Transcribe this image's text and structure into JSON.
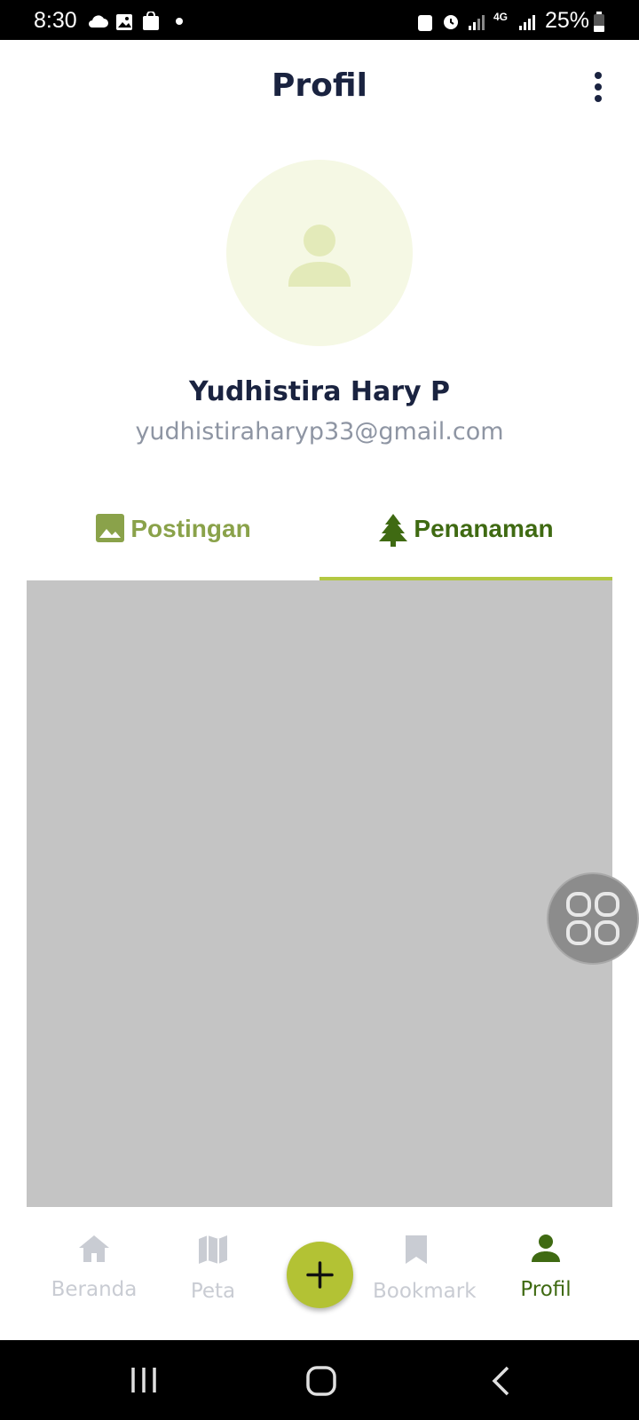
{
  "status_bar": {
    "time": "8:30",
    "battery": "25%",
    "network": "4G"
  },
  "app_bar": {
    "title": "Profil"
  },
  "profile": {
    "name": "Yudhistira Hary P",
    "email": "yudhistiraharyp33@gmail.com"
  },
  "tabs": [
    {
      "label": "Postingan",
      "icon": "image-icon",
      "selected": false
    },
    {
      "label": "Penanaman",
      "icon": "tree-icon",
      "selected": true
    }
  ],
  "bottom_nav": {
    "items": [
      {
        "label": "Beranda",
        "icon": "home-icon",
        "active": false
      },
      {
        "label": "Peta",
        "icon": "map-icon",
        "active": false
      },
      {
        "label": "Bookmark",
        "icon": "bookmark-icon",
        "active": false
      },
      {
        "label": "Profil",
        "icon": "person-icon",
        "active": true
      }
    ],
    "fab_icon": "plus-icon"
  },
  "colors": {
    "title": "#1a2340",
    "accent_green": "#3f6a12",
    "light_green": "#8aa24a",
    "indicator": "#b3c842",
    "fab": "#b3c234",
    "content_placeholder": "#c4c4c4"
  }
}
